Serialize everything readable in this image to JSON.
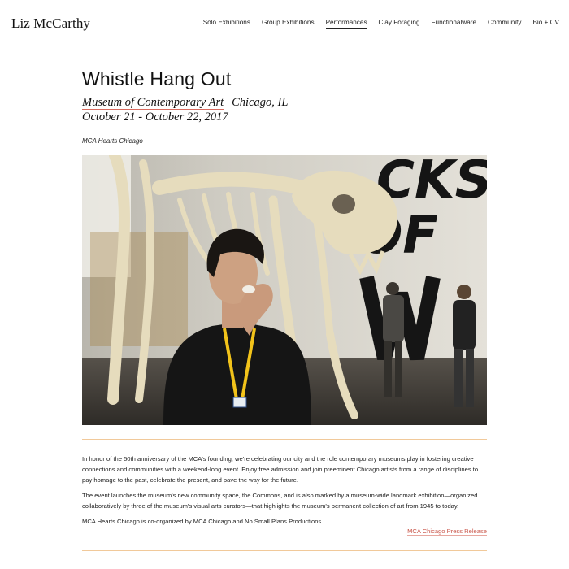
{
  "site": {
    "logo": "Liz McCarthy"
  },
  "nav": {
    "items": [
      {
        "label": "Solo Exhibitions",
        "active": false
      },
      {
        "label": "Group Exhibitions",
        "active": false
      },
      {
        "label": "Performances",
        "active": true
      },
      {
        "label": "Clay Foraging",
        "active": false
      },
      {
        "label": "Functionalware",
        "active": false
      },
      {
        "label": "Community",
        "active": false
      },
      {
        "label": "Bio + CV",
        "active": false
      }
    ]
  },
  "page": {
    "title": "Whistle Hang Out",
    "venue_link": "Museum of Contemporary Art",
    "separator": "|",
    "location": "Chicago, IL",
    "dates": "October 21 - October 22, 2017",
    "event_tag": "MCA Hearts Chicago"
  },
  "photo": {
    "wall_text": [
      "CKS",
      "OF"
    ],
    "colors": {
      "wall": "#dfdcd3",
      "skeleton": "#e2d7b7",
      "shirt": "#151515",
      "lanyard": "#f2c31a",
      "floor": "#3e3a34"
    }
  },
  "article": {
    "paragraphs": [
      "In honor of the 50th anniversary of the MCA's founding, we're celebrating our city and the role contemporary museums play in fostering creative connections and communities with a weekend-long event. Enjoy free admission and join preeminent Chicago artists from a range of disciplines to pay homage to the past, celebrate the present, and pave the way for the future.",
      "The event launches the museum's new community space, the Commons, and is also marked by a museum-wide landmark exhibition—organized collaboratively by three of the museum's visual arts curators—that highlights the museum's permanent collection of art from 1945 to today.",
      "MCA Hearts Chicago is co-organized by MCA Chicago and No Small Plans Productions."
    ],
    "press_link": "MCA Chicago Press Release"
  },
  "colors": {
    "accent_rule": "#f1c99a",
    "link_red": "#c9574b"
  }
}
